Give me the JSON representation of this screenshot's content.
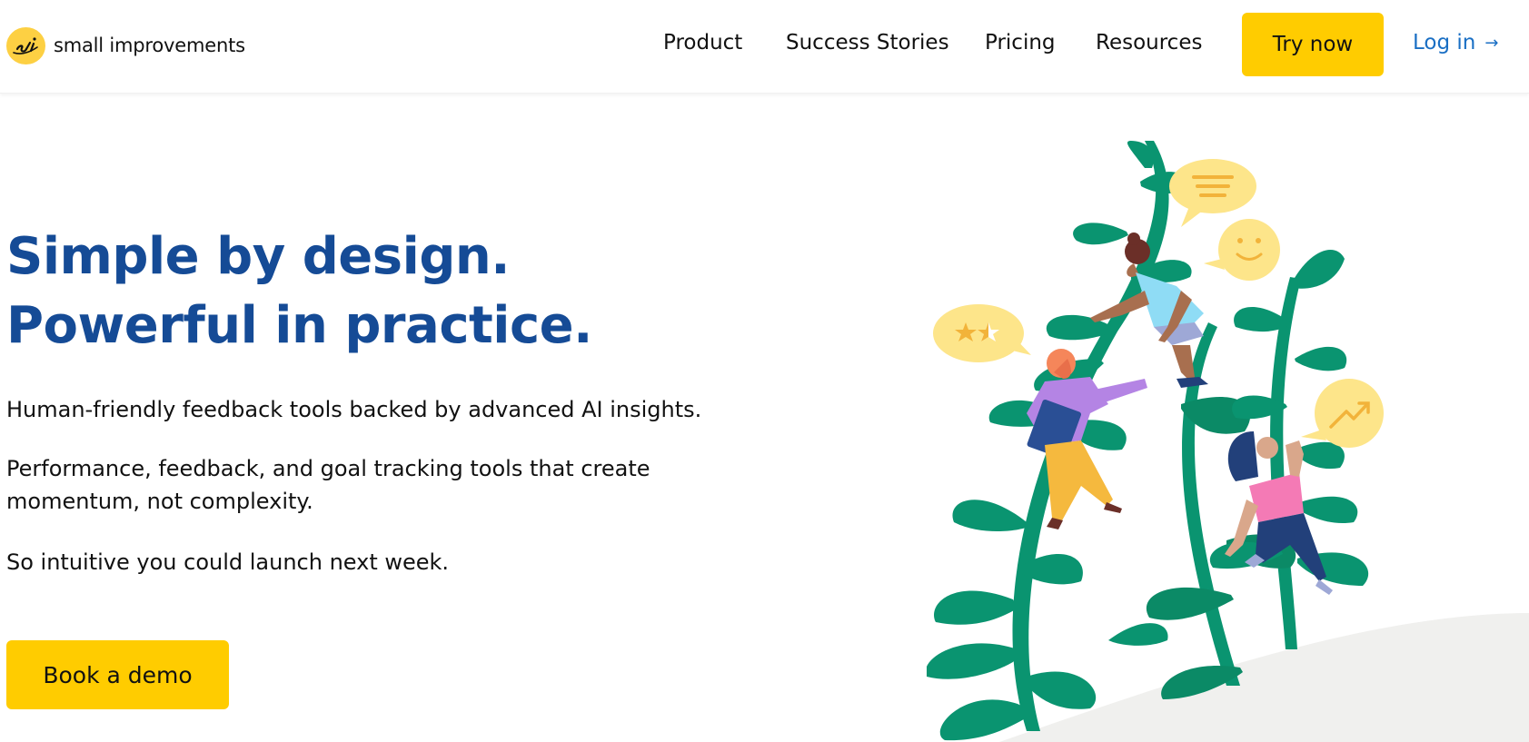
{
  "header": {
    "logo_text": "small improvements",
    "nav": [
      "Product",
      "Success Stories",
      "Pricing",
      "Resources"
    ],
    "try_label": "Try now",
    "login_label": "Log in",
    "login_arrow": "→"
  },
  "hero": {
    "title_line1": "Simple by design.",
    "title_line2": "Powerful in practice.",
    "p1": "Human-friendly feedback tools backed by advanced AI insights.",
    "p2_line1": "Performance, feedback, and goal tracking tools that create",
    "p2_line2": "momentum, not complexity.",
    "p3": "So intuitive you could launch next week.",
    "cta_label": "Book a demo"
  },
  "colors": {
    "accent_yellow": "#ffcc00",
    "title_blue": "#154b96",
    "link_blue": "#1a6fc4",
    "plant_green": "#0a9470"
  },
  "icons": [
    "logo-mark-icon",
    "arrow-right-icon"
  ]
}
